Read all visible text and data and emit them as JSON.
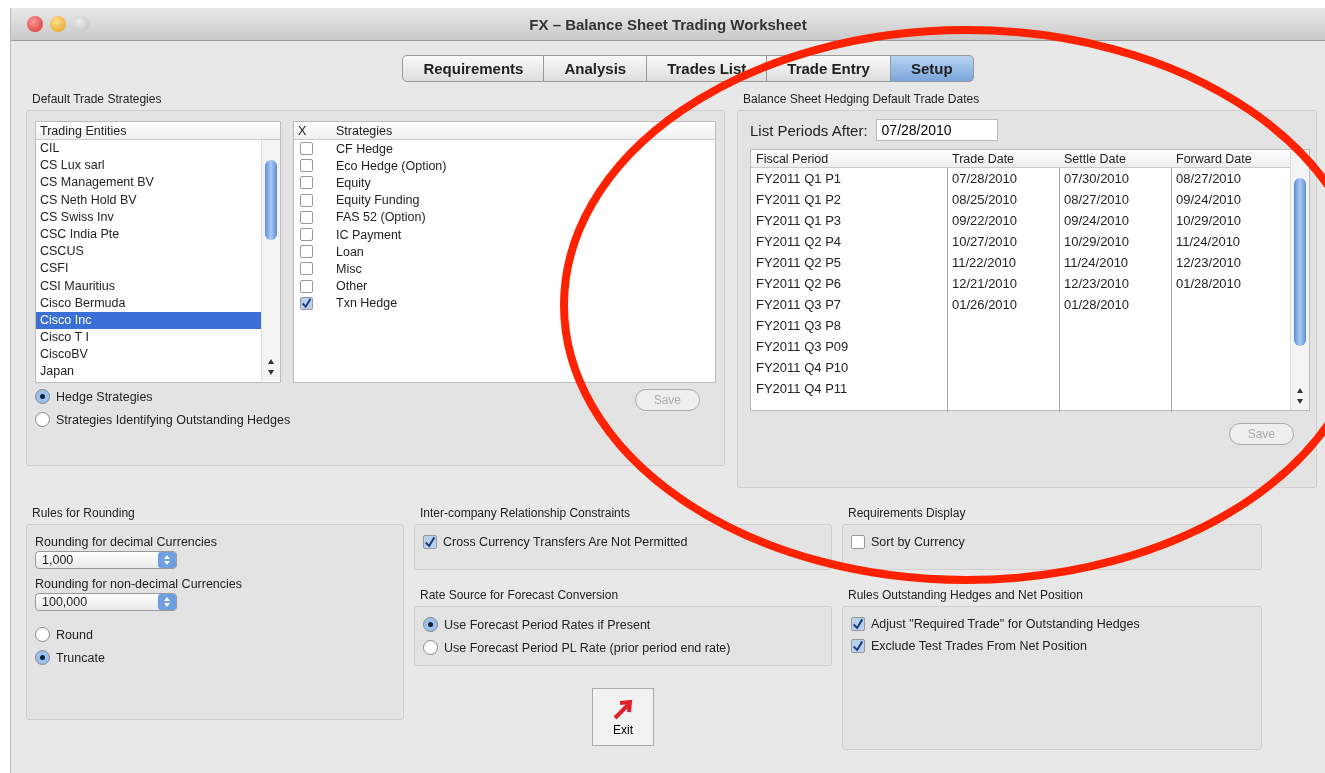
{
  "window": {
    "title": "FX – Balance Sheet Trading Worksheet"
  },
  "tabs": [
    {
      "label": "Requirements",
      "selected": false
    },
    {
      "label": "Analysis",
      "selected": false
    },
    {
      "label": "Trades List",
      "selected": false
    },
    {
      "label": "Trade Entry",
      "selected": false
    },
    {
      "label": "Setup",
      "selected": true
    }
  ],
  "default_trade_strategies": {
    "title": "Default Trade Strategies",
    "entities": {
      "header": "Trading Entities",
      "items": [
        {
          "label": "CIL",
          "selected": false
        },
        {
          "label": "CS Lux sarl",
          "selected": false
        },
        {
          "label": "CS Management BV",
          "selected": false
        },
        {
          "label": "CS Neth Hold BV",
          "selected": false
        },
        {
          "label": "CS Swiss Inv",
          "selected": false
        },
        {
          "label": "CSC India Pte",
          "selected": false
        },
        {
          "label": "CSCUS",
          "selected": false
        },
        {
          "label": "CSFI",
          "selected": false
        },
        {
          "label": "CSI Mauritius",
          "selected": false
        },
        {
          "label": "Cisco Bermuda",
          "selected": false
        },
        {
          "label": "Cisco Inc",
          "selected": true
        },
        {
          "label": "Cisco T I",
          "selected": false
        },
        {
          "label": "CiscoBV",
          "selected": false
        },
        {
          "label": "Japan",
          "selected": false
        }
      ]
    },
    "strategies": {
      "check_header": "X",
      "header": "Strategies",
      "items": [
        {
          "label": "CF Hedge",
          "checked": false
        },
        {
          "label": "Eco Hedge (Option)",
          "checked": false
        },
        {
          "label": "Equity",
          "checked": false
        },
        {
          "label": "Equity Funding",
          "checked": false
        },
        {
          "label": "FAS 52 (Option)",
          "checked": false
        },
        {
          "label": "IC Payment",
          "checked": false
        },
        {
          "label": "Loan",
          "checked": false
        },
        {
          "label": "Misc",
          "checked": false
        },
        {
          "label": "Other",
          "checked": false
        },
        {
          "label": "Txn Hedge",
          "checked": true
        }
      ]
    },
    "modes": [
      {
        "label": "Hedge Strategies",
        "selected": true
      },
      {
        "label": "Strategies Identifying Outstanding Hedges",
        "selected": false
      }
    ],
    "save": {
      "label": "Save",
      "disabled": true
    }
  },
  "trade_dates": {
    "title": "Balance Sheet Hedging Default Trade Dates",
    "filter_label": "List Periods After:",
    "filter_value": "07/28/2010",
    "columns": [
      "Fiscal Period",
      "Trade Date",
      "Settle Date",
      "Forward Date"
    ],
    "rows": [
      [
        "FY2011 Q1 P1",
        "07/28/2010",
        "07/30/2010",
        "08/27/2010"
      ],
      [
        "FY2011 Q1 P2",
        "08/25/2010",
        "08/27/2010",
        "09/24/2010"
      ],
      [
        "FY2011 Q1 P3",
        "09/22/2010",
        "09/24/2010",
        "10/29/2010"
      ],
      [
        "FY2011 Q2 P4",
        "10/27/2010",
        "10/29/2010",
        "11/24/2010"
      ],
      [
        "FY2011 Q2 P5",
        "11/22/2010",
        "11/24/2010",
        "12/23/2010"
      ],
      [
        "FY2011 Q2 P6",
        "12/21/2010",
        "12/23/2010",
        "01/28/2010"
      ],
      [
        "FY2011 Q3 P7",
        "01/26/2010",
        "01/28/2010",
        ""
      ],
      [
        "FY2011 Q3 P8",
        "",
        "",
        ""
      ],
      [
        "FY2011 Q3 P09",
        "",
        "",
        ""
      ],
      [
        "FY2011 Q4 P10",
        "",
        "",
        ""
      ],
      [
        "FY2011 Q4 P11",
        "",
        "",
        ""
      ]
    ],
    "save": {
      "label": "Save",
      "disabled": true
    }
  },
  "rounding": {
    "title": "Rules for Rounding",
    "decimal_label": "Rounding for decimal Currencies",
    "decimal_value": "1,000",
    "nondecimal_label": "Rounding for non-decimal Currencies",
    "nondecimal_value": "100,000",
    "modes": [
      {
        "label": "Round",
        "selected": false
      },
      {
        "label": "Truncate",
        "selected": true
      }
    ]
  },
  "intercompany": {
    "title": "Inter-company Relationship Constraints",
    "options": [
      {
        "label": "Cross Currency Transfers Are Not Permitted",
        "checked": true
      }
    ]
  },
  "rate_source": {
    "title": "Rate Source for Forecast Conversion",
    "options": [
      {
        "label": "Use Forecast Period Rates if Present",
        "selected": true
      },
      {
        "label": "Use Forecast Period PL Rate (prior period end rate)",
        "selected": false
      }
    ]
  },
  "requirements_display": {
    "title": "Requirements Display",
    "options": [
      {
        "label": "Sort by Currency",
        "checked": false
      }
    ]
  },
  "outstanding_rules": {
    "title": "Rules Outstanding Hedges and Net Position",
    "options": [
      {
        "label": "Adjust \"Required Trade\" for Outstanding Hedges",
        "checked": true
      },
      {
        "label": "Exclude Test Trades From Net Position",
        "checked": true
      }
    ]
  },
  "exit": {
    "label": "Exit"
  }
}
